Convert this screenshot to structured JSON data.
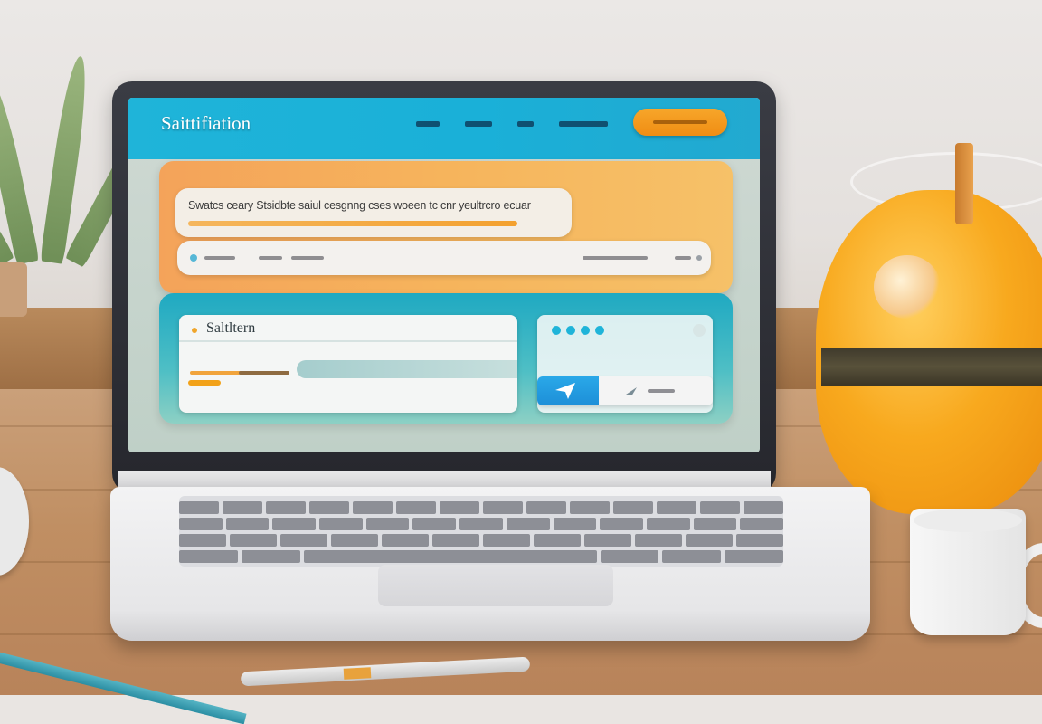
{
  "site": {
    "logo_text": "Saittifiation",
    "hero_headline": "Swatcs ceary Stsidbte saiul cesgnng cses woeen tc cnr yeultrcro ecuar",
    "feature_card_title": "Saltltern"
  },
  "colors": {
    "header": "#1fb4d9",
    "accent_orange": "#f08d13",
    "teal": "#1fa9c2",
    "send_blue": "#1d8fd8"
  },
  "icons": {
    "send": "paper-plane-icon",
    "dots": "three-dots-icon"
  }
}
